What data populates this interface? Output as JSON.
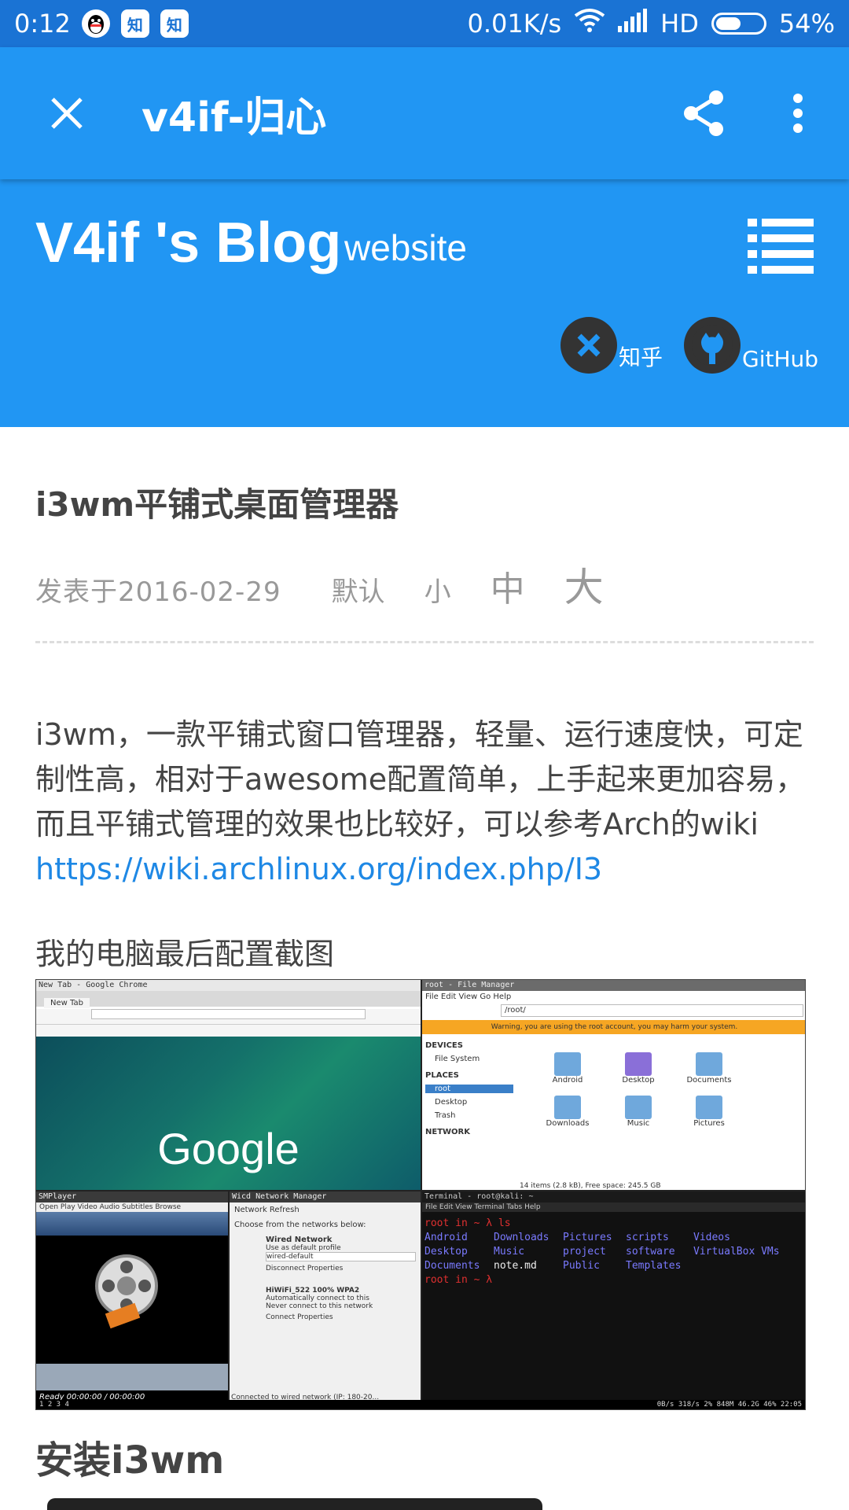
{
  "status_bar": {
    "time": "0:12",
    "notif_icons": [
      "qq-icon",
      "zhihu-icon",
      "zhihu-icon"
    ],
    "zhihu_glyph": "知",
    "net_speed": "0.01K/s",
    "hd": "HD",
    "battery_pct": "54%",
    "battery_level": 0.54
  },
  "toolbar": {
    "title": "v4if-归心"
  },
  "blog_header": {
    "title": "V4if 's Blog",
    "subtitle": "website",
    "social": [
      {
        "label": "知乎"
      },
      {
        "label": "GitHub"
      }
    ]
  },
  "article": {
    "title": "i3wm平铺式桌面管理器",
    "date": "发表于2016-02-29",
    "category": "默认",
    "font_small": "小",
    "font_medium": "中",
    "font_large": "大",
    "intro": "i3wm，一款平铺式窗口管理器，轻量、运行速度快，可定制性高，相对于awesome配置简单，上手起来更加容易，而且平铺式管理的效果也比较好，可以参考Arch的wiki ",
    "link": "https://wiki.archlinux.org/index.php/I3",
    "screenshot_caption": "我的电脑最后配置截图",
    "section_title": "安装i3wm"
  },
  "screenshot": {
    "chrome_title": "New Tab - Google Chrome",
    "chrome_tab": "New Tab",
    "chrome_logo": "Google",
    "fm_title": "root - File Manager",
    "fm_menu": "File  Edit  View  Go  Help",
    "fm_path": "/root/",
    "fm_warning": "Warning, you are using the root account, you may harm your system.",
    "fm_places": [
      "DEVICES",
      "File System",
      "PLACES",
      "root",
      "Desktop",
      "Trash",
      "NETWORK"
    ],
    "fm_folders": [
      "Android",
      "Desktop",
      "Documents",
      "Downloads",
      "Music",
      "Pictures"
    ],
    "fm_status": "14 items (2.8 kB), Free space: 245.5 GB",
    "smplayer_title": "SMPlayer",
    "smplayer_menu": "Open  Play  Video  Audio  Subtitles  Browse",
    "smplayer_status": "Ready        00:00:00 / 00:00:00",
    "wicd_title": "Wicd Network Manager",
    "wicd_lines": [
      "Network   Refresh",
      "Choose from the networks below:",
      "Wired Network",
      "Use as default profile",
      "wired-default",
      "Disconnect  Properties",
      "HiWiFi_522    100%   WPA2",
      "Automatically connect to this",
      "Never connect to this network",
      "Connect  Properties"
    ],
    "wicd_status": "Connected to wired network (IP: 180-20...",
    "term_title": "Terminal - root@kali: ~",
    "term_menu": "File  Edit  View  Terminal  Tabs  Help",
    "term_prompt": "root in ~ λ ls",
    "term_rows": [
      [
        "Android",
        "Downloads",
        "Pictures",
        "scripts",
        "Videos"
      ],
      [
        "Desktop",
        "Music",
        "project",
        "software",
        "VirtualBox VMs"
      ],
      [
        "Documents",
        "note.md",
        "Public",
        "Templates",
        ""
      ]
    ],
    "term_prompt2": "root in ~ λ",
    "taskbar_left": "1 2 3 4",
    "taskbar_right": "0B/s 318/s 2% 848M 46.2G 46% 22:05"
  },
  "colors": {
    "status_bar": "#1a73d4",
    "primary": "#2196f3",
    "link": "#1e88e5"
  }
}
